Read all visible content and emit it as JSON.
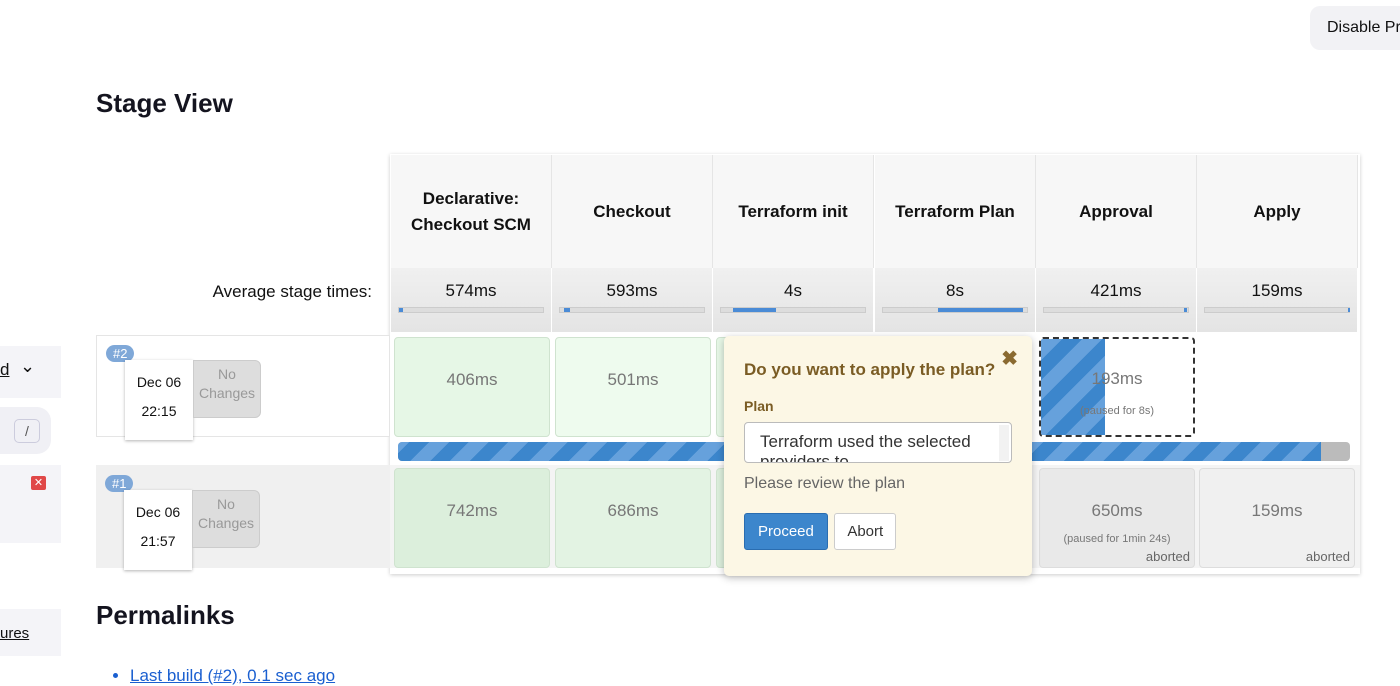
{
  "top": {
    "disable_label": "Disable Project"
  },
  "sidebar": {
    "item1_label": "d",
    "item3_label": "ures",
    "shortcut_key": "/"
  },
  "stage_view": {
    "title": "Stage View",
    "avg_label": "Average stage times:",
    "stages": [
      {
        "name": "Declarative: Checkout SCM",
        "avg": "574ms",
        "bar_start": 0.0,
        "bar_fraction": 0.03
      },
      {
        "name": "Checkout",
        "avg": "593ms",
        "bar_start": 0.03,
        "bar_fraction": 0.04
      },
      {
        "name": "Terraform init",
        "avg": "4s",
        "bar_start": 0.08,
        "bar_fraction": 0.3
      },
      {
        "name": "Terraform Plan",
        "avg": "8s",
        "bar_start": 0.38,
        "bar_fraction": 0.59
      },
      {
        "name": "Approval",
        "avg": "421ms",
        "bar_start": 0.97,
        "bar_fraction": 0.02
      },
      {
        "name": "Apply",
        "avg": "159ms",
        "bar_start": 0.99,
        "bar_fraction": 0.01
      }
    ],
    "builds": [
      {
        "number": "#2",
        "date": "Dec 06",
        "time": "22:15",
        "changes": "No Changes",
        "cells": [
          "406ms",
          "501ms"
        ],
        "approval": {
          "time": "193ms",
          "paused": "(paused for 8s)",
          "progress": 0.42
        },
        "progress": 0.97
      },
      {
        "number": "#1",
        "date": "Dec 06",
        "time": "21:57",
        "changes": "No Changes",
        "cells": [
          "742ms",
          "686ms"
        ],
        "approval": {
          "time": "650ms",
          "paused": "(paused for 1min 24s)",
          "status": "aborted"
        },
        "apply": {
          "time": "159ms",
          "status": "aborted"
        }
      }
    ]
  },
  "popover": {
    "title": "Do you want to apply the plan?",
    "param_label": "Plan",
    "param_value": "Terraform used the selected providers to",
    "description": "Please review the plan",
    "proceed": "Proceed",
    "abort": "Abort"
  },
  "permalinks": {
    "title": "Permalinks",
    "items": [
      "Last build (#2), 0.1 sec ago"
    ]
  },
  "colors": {
    "accent": "#3c86cc",
    "success": "#e6f7e6",
    "popover": "#fcf7e5",
    "title": "#7a5c24"
  }
}
